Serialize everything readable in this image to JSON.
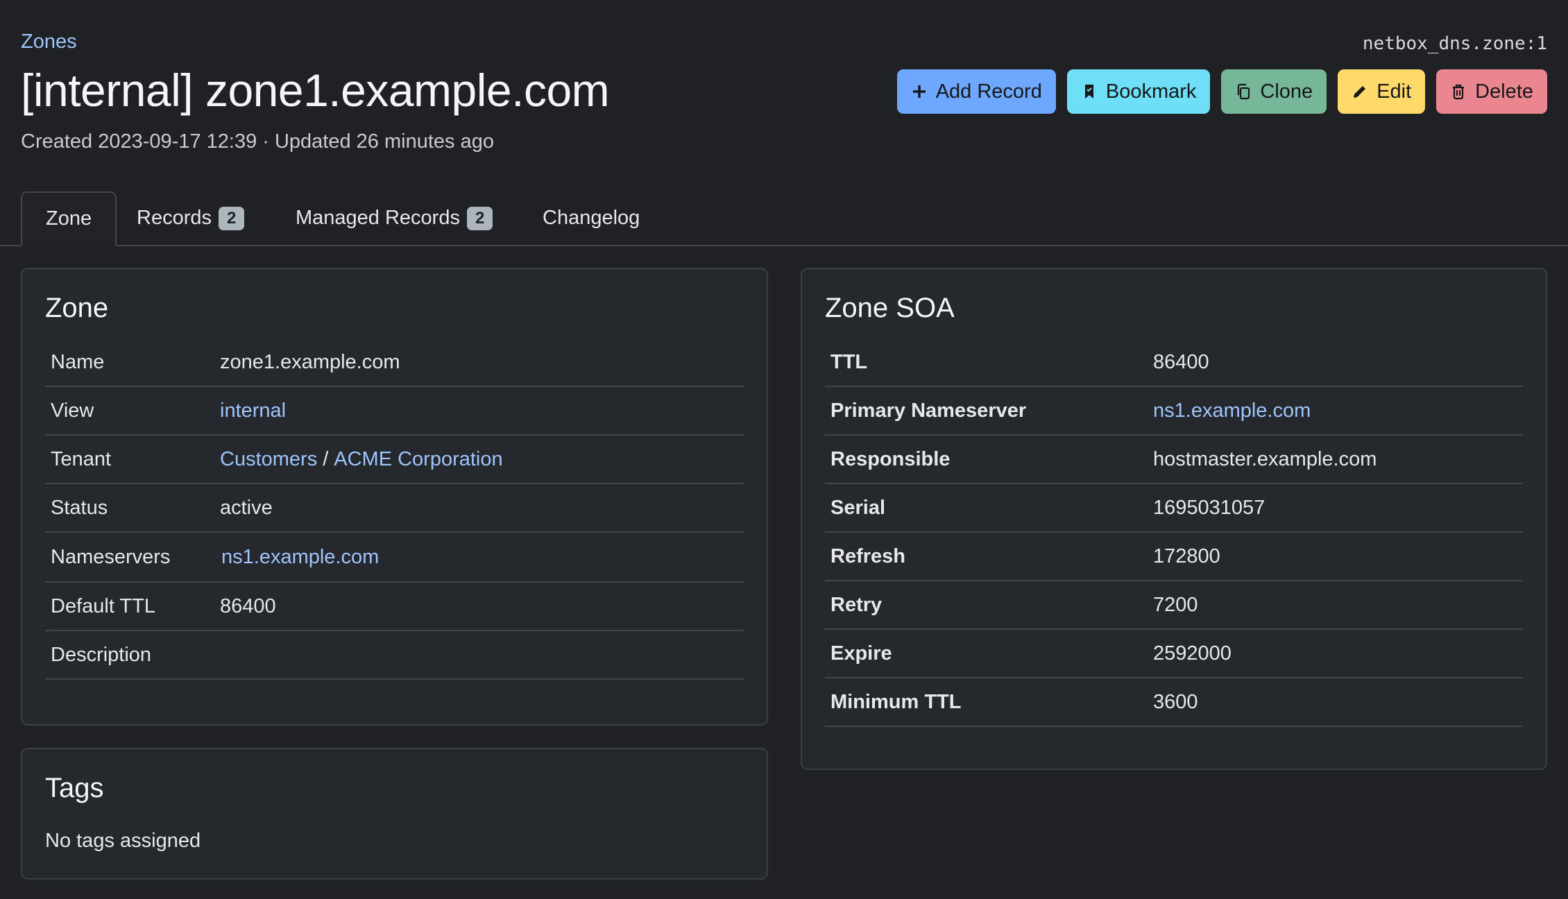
{
  "breadcrumb": "Zones",
  "object_id": "netbox_dns.zone:1",
  "title": "[internal] zone1.example.com",
  "meta": "Created 2023-09-17 12:39 · Updated 26 minutes ago",
  "buttons": {
    "add_record": "Add Record",
    "bookmark": "Bookmark",
    "clone": "Clone",
    "edit": "Edit",
    "delete": "Delete"
  },
  "tabs": {
    "zone": "Zone",
    "records": "Records",
    "records_count": "2",
    "managed": "Managed Records",
    "managed_count": "2",
    "changelog": "Changelog"
  },
  "zone_card": {
    "title": "Zone",
    "name_label": "Name",
    "name_value": "zone1.example.com",
    "view_label": "View",
    "view_value": "internal",
    "tenant_label": "Tenant",
    "tenant_group": "Customers",
    "tenant_sep": "/",
    "tenant_value": "ACME Corporation",
    "status_label": "Status",
    "status_value": "active",
    "ns_label": "Nameservers",
    "ns_value": "ns1.example.com",
    "ttl_label": "Default TTL",
    "ttl_value": "86400",
    "desc_label": "Description",
    "desc_value": ""
  },
  "tags_card": {
    "title": "Tags",
    "empty": "No tags assigned"
  },
  "soa_card": {
    "title": "Zone SOA",
    "ttl_label": "TTL",
    "ttl_value": "86400",
    "mname_label": "Primary Nameserver",
    "mname_value": "ns1.example.com",
    "rname_label": "Responsible",
    "rname_value": "hostmaster.example.com",
    "serial_label": "Serial",
    "serial_value": "1695031057",
    "refresh_label": "Refresh",
    "refresh_value": "172800",
    "retry_label": "Retry",
    "retry_value": "7200",
    "expire_label": "Expire",
    "expire_value": "2592000",
    "minimum_label": "Minimum TTL",
    "minimum_value": "3600"
  },
  "colors": {
    "background": "#1f2124",
    "card": "#25282c",
    "link": "#9ec5fe",
    "btn_add": "#6ea8fe",
    "btn_bookmark": "#6edff6",
    "btn_clone": "#75b798",
    "btn_edit": "#ffda6a",
    "btn_delete": "#ea868f"
  }
}
